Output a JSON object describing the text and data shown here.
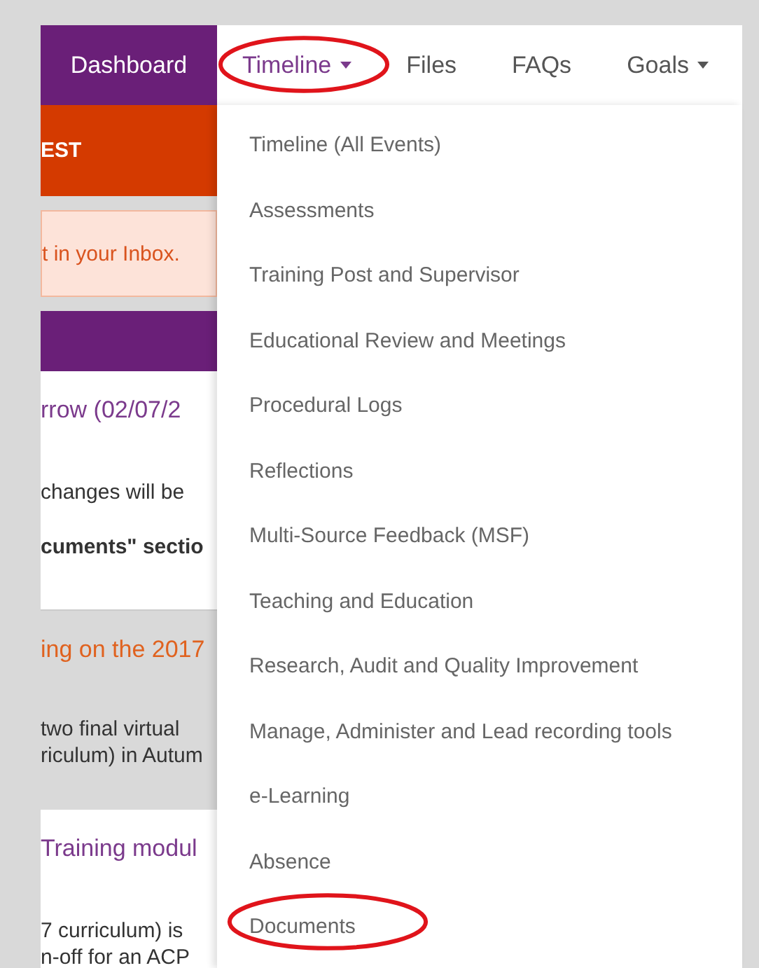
{
  "nav": {
    "items": [
      {
        "label": "Dashboard",
        "kind": "home",
        "selected": false,
        "circled": false
      },
      {
        "label": "Timeline",
        "kind": "dropdown",
        "selected": true,
        "circled": true
      },
      {
        "label": "Files",
        "kind": "link",
        "selected": false,
        "circled": false
      },
      {
        "label": "FAQs",
        "kind": "link",
        "selected": false,
        "circled": false
      },
      {
        "label": "Goals",
        "kind": "dropdown",
        "selected": false,
        "circled": false
      }
    ]
  },
  "dropdown": {
    "items": [
      {
        "label": "Timeline (All Events)",
        "circled": false
      },
      {
        "label": "Assessments",
        "circled": false
      },
      {
        "label": "Training Post and Supervisor",
        "circled": false
      },
      {
        "label": "Educational Review and Meetings",
        "circled": false
      },
      {
        "label": "Procedural Logs",
        "circled": false
      },
      {
        "label": "Reflections",
        "circled": false
      },
      {
        "label": "Multi-Source Feedback (MSF)",
        "circled": false
      },
      {
        "label": "Teaching and Education",
        "circled": false
      },
      {
        "label": "Research, Audit and Quality Improvement",
        "circled": false
      },
      {
        "label": "Manage, Administer and Lead recording tools",
        "circled": false
      },
      {
        "label": "e-Learning",
        "circled": false
      },
      {
        "label": "Absence",
        "circled": false
      },
      {
        "label": "Documents",
        "circled": true
      }
    ]
  },
  "content": [
    {
      "kind": "banner",
      "lines": [
        "EST"
      ]
    },
    {
      "kind": "alert",
      "lines": [
        "t in your Inbox."
      ]
    },
    {
      "kind": "header"
    },
    {
      "kind": "news",
      "title": "rrow (02/07/2",
      "lines": [
        "changes will be",
        "cuments\" sectio"
      ],
      "bold_last": true
    },
    {
      "kind": "news-alt",
      "title": "ing on the 2017",
      "lines": [
        "two final virtual",
        "riculum) in Autum"
      ],
      "bold_last": false
    },
    {
      "kind": "news",
      "title": "Training modul",
      "lines": [
        "7 curriculum) is",
        "n-off for an ACP"
      ],
      "bold_last": false
    }
  ]
}
